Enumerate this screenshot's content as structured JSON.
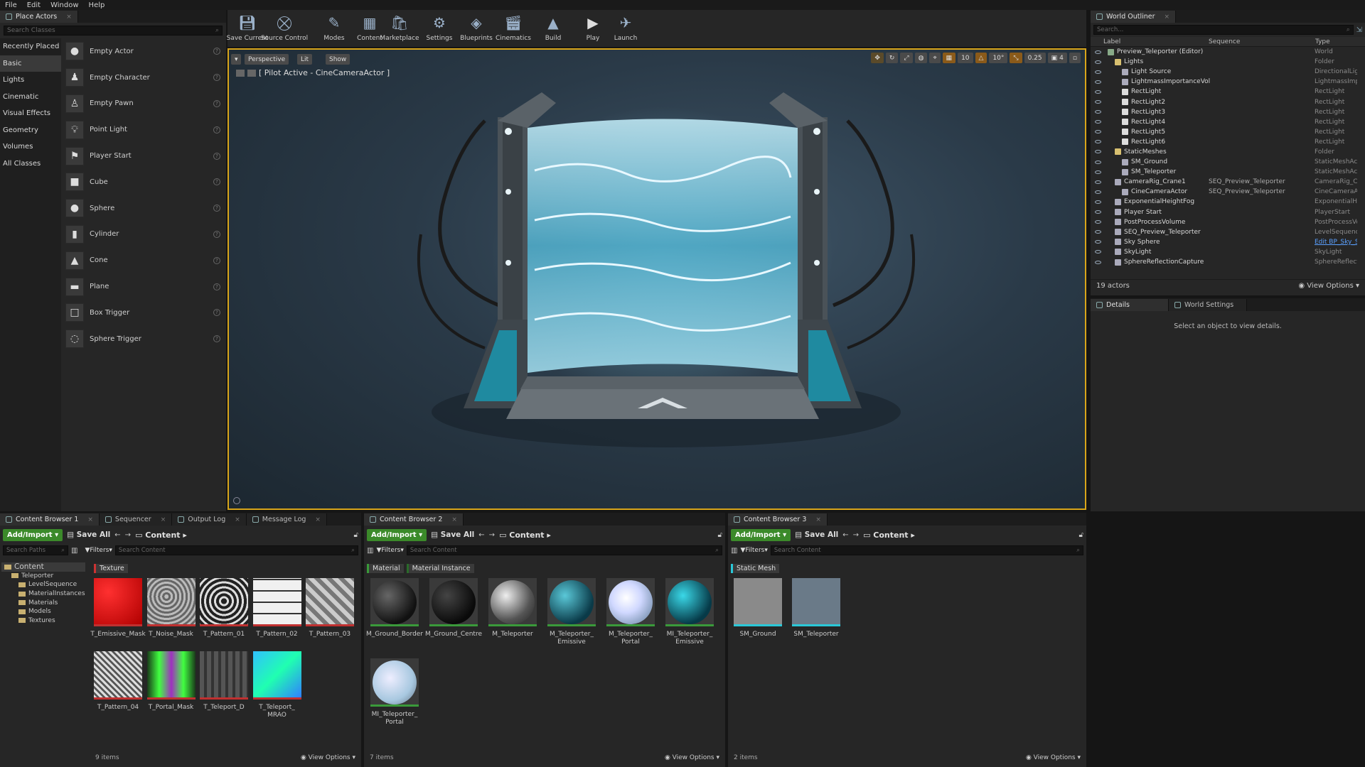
{
  "menu": [
    "File",
    "Edit",
    "Window",
    "Help"
  ],
  "place_actors": {
    "tab": "Place Actors",
    "search_placeholder": "Search Classes",
    "categories": [
      "Recently Placed",
      "Basic",
      "Lights",
      "Cinematic",
      "Visual Effects",
      "Geometry",
      "Volumes",
      "All Classes"
    ],
    "items": [
      "Empty Actor",
      "Empty Character",
      "Empty Pawn",
      "Point Light",
      "Player Start",
      "Cube",
      "Sphere",
      "Cylinder",
      "Cone",
      "Plane",
      "Box Trigger",
      "Sphere Trigger"
    ]
  },
  "toolbar": [
    "Save Current",
    "Source Control",
    "Modes",
    "Content",
    "Marketplace",
    "Settings",
    "Blueprints",
    "Cinematics",
    "Build",
    "Play",
    "Launch"
  ],
  "viewport": {
    "perspective": "Perspective",
    "lit": "Lit",
    "show": "Show",
    "pilot": "[ Pilot Active - CineCameraActor ]",
    "grid": "10",
    "angle": "10°",
    "scale": "0.25",
    "cam": "4"
  },
  "outliner": {
    "tab": "World Outliner",
    "search_placeholder": "Search...",
    "col_label": "Label",
    "col_seq": "Sequence",
    "col_type": "Type",
    "rows": [
      {
        "l": "Preview_Teleporter (Editor)",
        "s": "",
        "t": "World",
        "d": 0
      },
      {
        "l": "Lights",
        "s": "",
        "t": "Folder",
        "d": 1
      },
      {
        "l": "Light Source",
        "s": "",
        "t": "DirectionalLigh",
        "d": 2
      },
      {
        "l": "LightmassImportanceVol",
        "s": "",
        "t": "LightmassImpc",
        "d": 2
      },
      {
        "l": "RectLight",
        "s": "",
        "t": "RectLight",
        "d": 2
      },
      {
        "l": "RectLight2",
        "s": "",
        "t": "RectLight",
        "d": 2
      },
      {
        "l": "RectLight3",
        "s": "",
        "t": "RectLight",
        "d": 2
      },
      {
        "l": "RectLight4",
        "s": "",
        "t": "RectLight",
        "d": 2
      },
      {
        "l": "RectLight5",
        "s": "",
        "t": "RectLight",
        "d": 2
      },
      {
        "l": "RectLight6",
        "s": "",
        "t": "RectLight",
        "d": 2
      },
      {
        "l": "StaticMeshes",
        "s": "",
        "t": "Folder",
        "d": 1
      },
      {
        "l": "SM_Ground",
        "s": "",
        "t": "StaticMeshAct",
        "d": 2
      },
      {
        "l": "SM_Teleporter",
        "s": "",
        "t": "StaticMeshAct",
        "d": 2
      },
      {
        "l": "CameraRig_Crane1",
        "s": "SEQ_Preview_Teleporter",
        "t": "CameraRig_Cra",
        "d": 1
      },
      {
        "l": "CineCameraActor",
        "s": "SEQ_Preview_Teleporter",
        "t": "CineCameraAc",
        "d": 2
      },
      {
        "l": "ExponentialHeightFog",
        "s": "",
        "t": "ExponentialHei",
        "d": 1
      },
      {
        "l": "Player Start",
        "s": "",
        "t": "PlayerStart",
        "d": 1
      },
      {
        "l": "PostProcessVolume",
        "s": "",
        "t": "PostProcessVo",
        "d": 1
      },
      {
        "l": "SEQ_Preview_Teleporter",
        "s": "",
        "t": "LevelSequence",
        "d": 1
      },
      {
        "l": "Sky Sphere",
        "s": "",
        "t": "Edit BP_Sky_S",
        "d": 1
      },
      {
        "l": "SkyLight",
        "s": "",
        "t": "SkyLight",
        "d": 1
      },
      {
        "l": "SphereReflectionCapture",
        "s": "",
        "t": "SphereReflectic",
        "d": 1
      }
    ],
    "count": "19 actors",
    "view_options": "View Options"
  },
  "details": {
    "tab1": "Details",
    "tab2": "World Settings",
    "empty": "Select an object to view details."
  },
  "bottom_tabs": [
    "Content Browser 1",
    "Sequencer",
    "Output Log",
    "Message Log"
  ],
  "cb_common": {
    "add": "Add/Import",
    "save": "Save All",
    "crumb": "Content",
    "filters": "Filters",
    "search": "Search Content",
    "view_options": "View Options"
  },
  "cb1": {
    "paths_search": "Search Paths",
    "tree": [
      "Content",
      "Teleporter",
      "LevelSequence",
      "MaterialInstances",
      "Materials",
      "Models",
      "Textures"
    ],
    "chip": "Texture",
    "assets": [
      "T_Emissive_Mask",
      "T_Noise_Mask",
      "T_Pattern_01",
      "T_Pattern_02",
      "T_Pattern_03",
      "T_Pattern_04",
      "T_Portal_Mask",
      "T_Teleport_D",
      "T_Teleport_ MRAO"
    ],
    "count": "9 items"
  },
  "cb2": {
    "tab": "Content Browser 2",
    "chip1": "Material",
    "chip2": "Material Instance",
    "assets": [
      "M_Ground_Border",
      "M_Ground_Centre",
      "M_Teleporter",
      "M_Teleporter_ Emissive",
      "M_Teleporter_ Portal",
      "MI_Teleporter_ Emissive",
      "MI_Teleporter_ Portal"
    ],
    "count": "7 items"
  },
  "cb3": {
    "tab": "Content Browser 3",
    "chip": "Static Mesh",
    "assets": [
      "SM_Ground",
      "SM_Teleporter"
    ],
    "count": "2 items"
  }
}
